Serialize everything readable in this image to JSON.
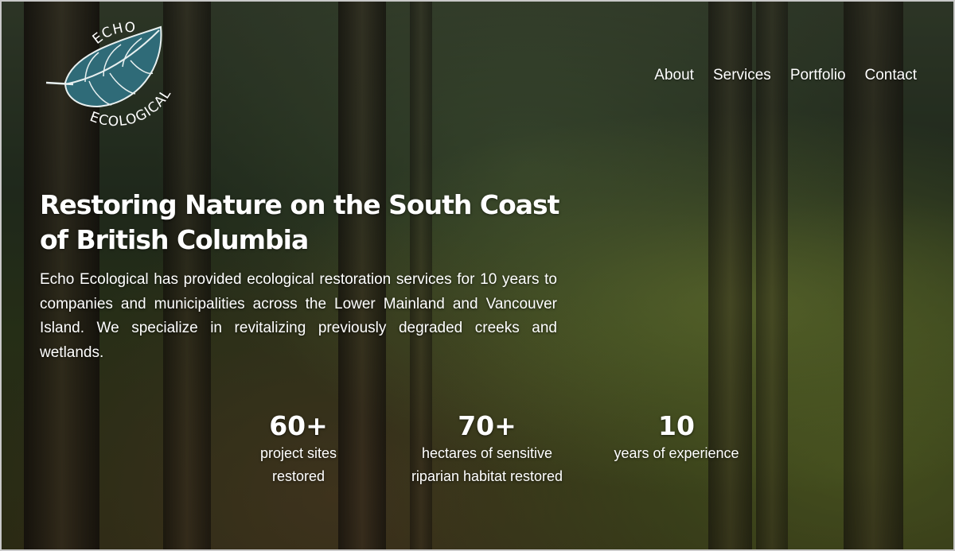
{
  "brand": {
    "logo_top": "ECHO",
    "logo_bottom": "ECOLOGICAL",
    "leaf_color": "#2f6b78",
    "accent_color": "#ffffff"
  },
  "nav": {
    "items": [
      {
        "label": "About"
      },
      {
        "label": "Services"
      },
      {
        "label": "Portfolio"
      },
      {
        "label": "Contact"
      }
    ]
  },
  "hero": {
    "title": "Restoring Nature on the South Coast of British Columbia",
    "description": "Echo Ecological has provided ecological restoration services for 10 years to companies and municipalities across the Lower Mainland and Vancouver Island. We specialize in revitalizing previously degraded creeks and wetlands."
  },
  "stats": [
    {
      "number": "60+",
      "label": "project sites restored"
    },
    {
      "number": "70+",
      "label": "hectares of sensitive riparian habitat restored"
    },
    {
      "number": "10",
      "label": "years of experience"
    }
  ]
}
